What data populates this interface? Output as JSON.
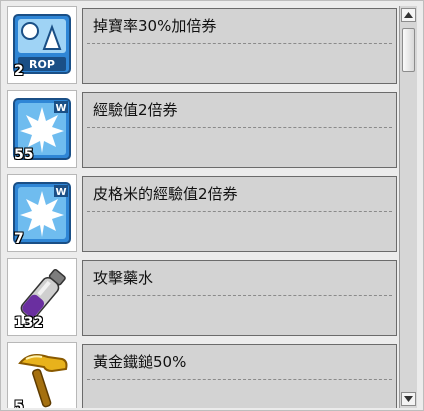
{
  "items": [
    {
      "name": "掉寶率30%加倍券",
      "count": "2",
      "icon": "drop-rate-coupon-icon",
      "badge": "ROP"
    },
    {
      "name": "經驗值2倍券",
      "count": "55",
      "icon": "exp-coupon-icon",
      "badge": "W"
    },
    {
      "name": "皮格米的經驗值2倍券",
      "count": "7",
      "icon": "exp-coupon-icon",
      "badge": "W"
    },
    {
      "name": "攻擊藥水",
      "count": "132",
      "icon": "attack-potion-icon"
    },
    {
      "name": "黃金鐵鎚50%",
      "count": "5",
      "icon": "golden-hammer-icon"
    }
  ],
  "colors": {
    "icon_blue": "#2f86d6",
    "icon_light": "#9fd3f5",
    "info_bg": "#d3d3d3",
    "hammer_gold": "#e8b21c",
    "potion_purple": "#6a2fa0"
  }
}
